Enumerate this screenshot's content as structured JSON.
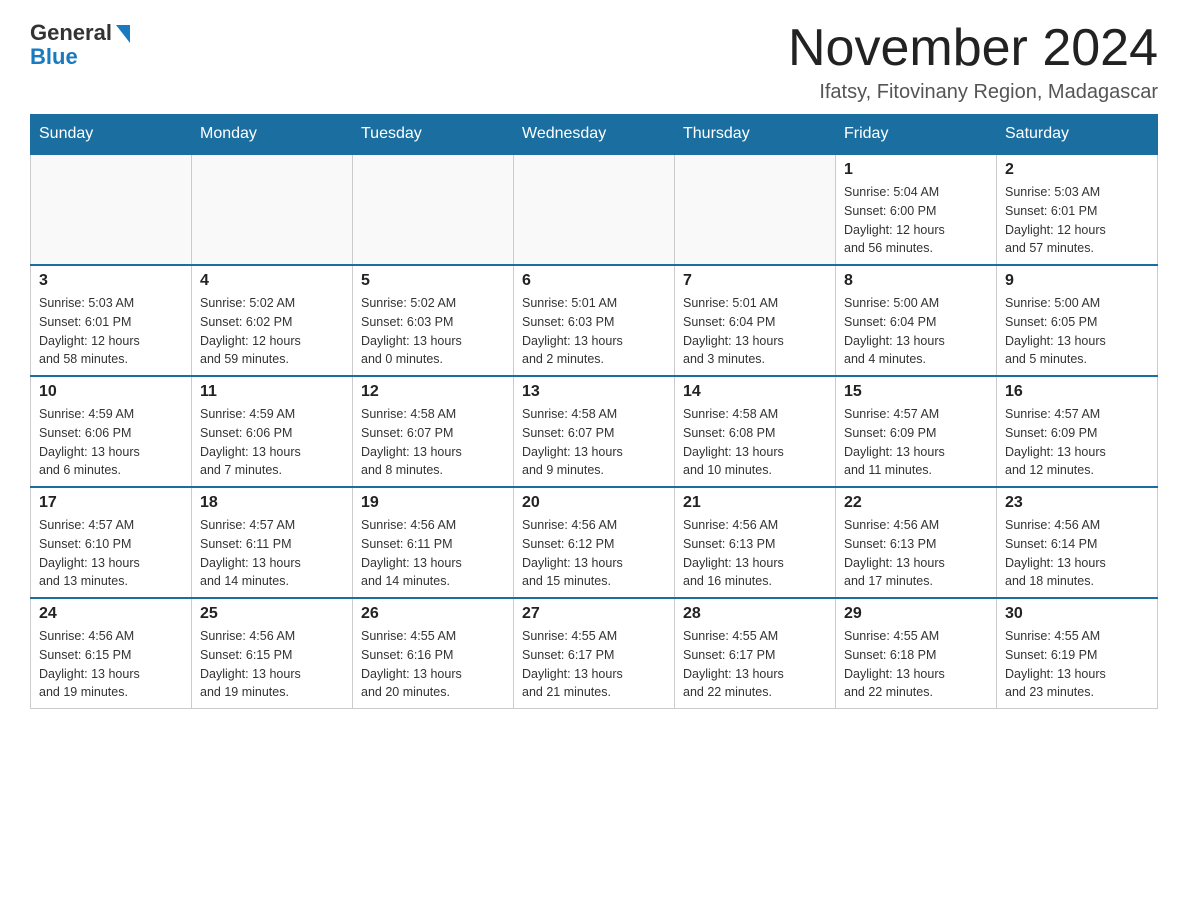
{
  "logo": {
    "general": "General",
    "blue": "Blue"
  },
  "title": "November 2024",
  "subtitle": "Ifatsy, Fitovinany Region, Madagascar",
  "weekdays": [
    "Sunday",
    "Monday",
    "Tuesday",
    "Wednesday",
    "Thursday",
    "Friday",
    "Saturday"
  ],
  "weeks": [
    [
      {
        "day": "",
        "info": ""
      },
      {
        "day": "",
        "info": ""
      },
      {
        "day": "",
        "info": ""
      },
      {
        "day": "",
        "info": ""
      },
      {
        "day": "",
        "info": ""
      },
      {
        "day": "1",
        "info": "Sunrise: 5:04 AM\nSunset: 6:00 PM\nDaylight: 12 hours\nand 56 minutes."
      },
      {
        "day": "2",
        "info": "Sunrise: 5:03 AM\nSunset: 6:01 PM\nDaylight: 12 hours\nand 57 minutes."
      }
    ],
    [
      {
        "day": "3",
        "info": "Sunrise: 5:03 AM\nSunset: 6:01 PM\nDaylight: 12 hours\nand 58 minutes."
      },
      {
        "day": "4",
        "info": "Sunrise: 5:02 AM\nSunset: 6:02 PM\nDaylight: 12 hours\nand 59 minutes."
      },
      {
        "day": "5",
        "info": "Sunrise: 5:02 AM\nSunset: 6:03 PM\nDaylight: 13 hours\nand 0 minutes."
      },
      {
        "day": "6",
        "info": "Sunrise: 5:01 AM\nSunset: 6:03 PM\nDaylight: 13 hours\nand 2 minutes."
      },
      {
        "day": "7",
        "info": "Sunrise: 5:01 AM\nSunset: 6:04 PM\nDaylight: 13 hours\nand 3 minutes."
      },
      {
        "day": "8",
        "info": "Sunrise: 5:00 AM\nSunset: 6:04 PM\nDaylight: 13 hours\nand 4 minutes."
      },
      {
        "day": "9",
        "info": "Sunrise: 5:00 AM\nSunset: 6:05 PM\nDaylight: 13 hours\nand 5 minutes."
      }
    ],
    [
      {
        "day": "10",
        "info": "Sunrise: 4:59 AM\nSunset: 6:06 PM\nDaylight: 13 hours\nand 6 minutes."
      },
      {
        "day": "11",
        "info": "Sunrise: 4:59 AM\nSunset: 6:06 PM\nDaylight: 13 hours\nand 7 minutes."
      },
      {
        "day": "12",
        "info": "Sunrise: 4:58 AM\nSunset: 6:07 PM\nDaylight: 13 hours\nand 8 minutes."
      },
      {
        "day": "13",
        "info": "Sunrise: 4:58 AM\nSunset: 6:07 PM\nDaylight: 13 hours\nand 9 minutes."
      },
      {
        "day": "14",
        "info": "Sunrise: 4:58 AM\nSunset: 6:08 PM\nDaylight: 13 hours\nand 10 minutes."
      },
      {
        "day": "15",
        "info": "Sunrise: 4:57 AM\nSunset: 6:09 PM\nDaylight: 13 hours\nand 11 minutes."
      },
      {
        "day": "16",
        "info": "Sunrise: 4:57 AM\nSunset: 6:09 PM\nDaylight: 13 hours\nand 12 minutes."
      }
    ],
    [
      {
        "day": "17",
        "info": "Sunrise: 4:57 AM\nSunset: 6:10 PM\nDaylight: 13 hours\nand 13 minutes."
      },
      {
        "day": "18",
        "info": "Sunrise: 4:57 AM\nSunset: 6:11 PM\nDaylight: 13 hours\nand 14 minutes."
      },
      {
        "day": "19",
        "info": "Sunrise: 4:56 AM\nSunset: 6:11 PM\nDaylight: 13 hours\nand 14 minutes."
      },
      {
        "day": "20",
        "info": "Sunrise: 4:56 AM\nSunset: 6:12 PM\nDaylight: 13 hours\nand 15 minutes."
      },
      {
        "day": "21",
        "info": "Sunrise: 4:56 AM\nSunset: 6:13 PM\nDaylight: 13 hours\nand 16 minutes."
      },
      {
        "day": "22",
        "info": "Sunrise: 4:56 AM\nSunset: 6:13 PM\nDaylight: 13 hours\nand 17 minutes."
      },
      {
        "day": "23",
        "info": "Sunrise: 4:56 AM\nSunset: 6:14 PM\nDaylight: 13 hours\nand 18 minutes."
      }
    ],
    [
      {
        "day": "24",
        "info": "Sunrise: 4:56 AM\nSunset: 6:15 PM\nDaylight: 13 hours\nand 19 minutes."
      },
      {
        "day": "25",
        "info": "Sunrise: 4:56 AM\nSunset: 6:15 PM\nDaylight: 13 hours\nand 19 minutes."
      },
      {
        "day": "26",
        "info": "Sunrise: 4:55 AM\nSunset: 6:16 PM\nDaylight: 13 hours\nand 20 minutes."
      },
      {
        "day": "27",
        "info": "Sunrise: 4:55 AM\nSunset: 6:17 PM\nDaylight: 13 hours\nand 21 minutes."
      },
      {
        "day": "28",
        "info": "Sunrise: 4:55 AM\nSunset: 6:17 PM\nDaylight: 13 hours\nand 22 minutes."
      },
      {
        "day": "29",
        "info": "Sunrise: 4:55 AM\nSunset: 6:18 PM\nDaylight: 13 hours\nand 22 minutes."
      },
      {
        "day": "30",
        "info": "Sunrise: 4:55 AM\nSunset: 6:19 PM\nDaylight: 13 hours\nand 23 minutes."
      }
    ]
  ]
}
